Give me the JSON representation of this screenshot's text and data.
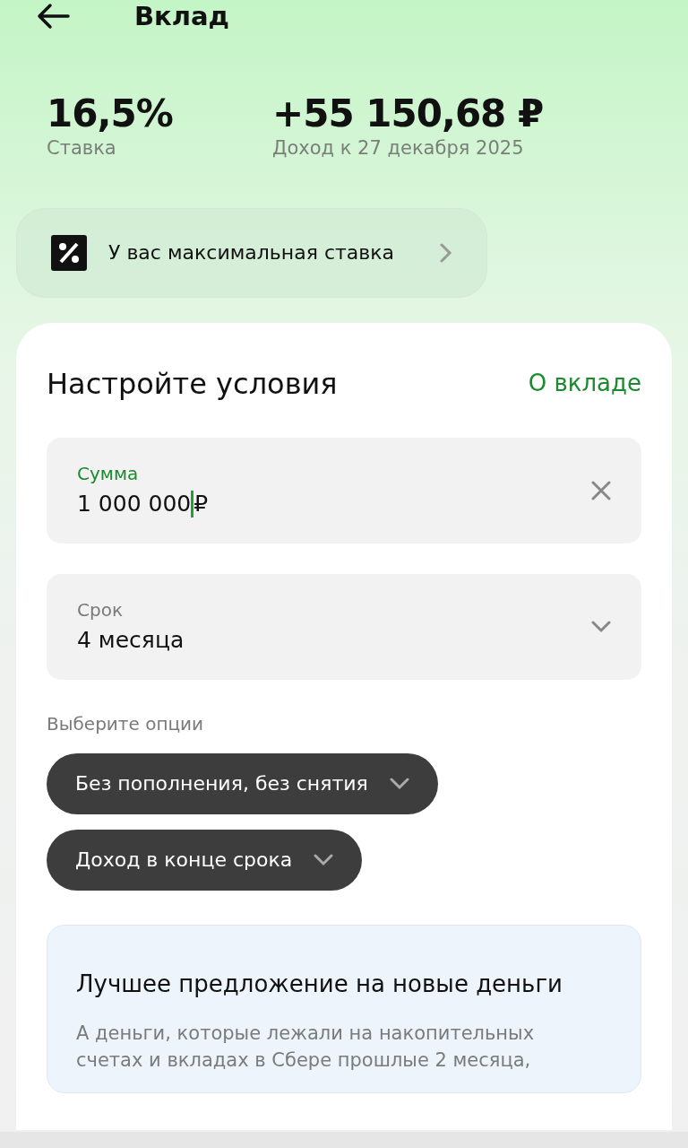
{
  "header": {
    "title": "Вклад"
  },
  "stats": [
    {
      "value": "16,5%",
      "label": "Ставка"
    },
    {
      "value": "+55 150,68 ₽",
      "label": "Доход к 27 декабря 2025"
    }
  ],
  "banner": {
    "text": "У вас максимальная ставка"
  },
  "settings": {
    "title": "Настройте условия",
    "link": "О вкладе",
    "fields": [
      {
        "kind": "input",
        "label": "Сумма",
        "value": "1 000 000",
        "suffix": "₽",
        "focused": true
      },
      {
        "kind": "select",
        "label": "Срок",
        "value": "4 месяца",
        "focused": false
      }
    ],
    "options_label": "Выберите опции",
    "options": [
      "Без пополнения, без снятия",
      "Доход в конце срока"
    ],
    "promo": {
      "title": "Лучшее предложение на новые деньги",
      "text": "А деньги, которые лежали на накопительных счетах и вкладах в Сбере прошлые 2 месяца,"
    }
  }
}
